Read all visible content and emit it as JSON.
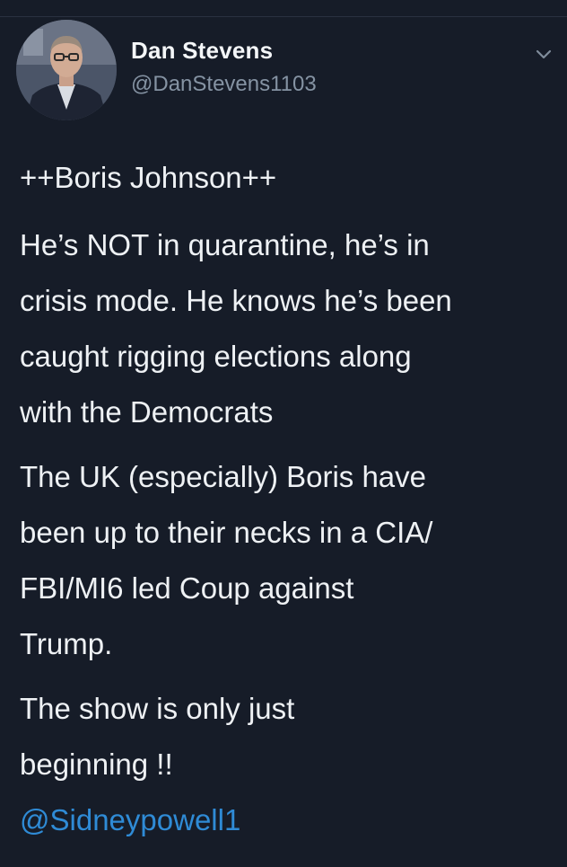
{
  "user": {
    "display_name": "Dan Stevens",
    "handle": "@DanStevens1103"
  },
  "icons": {
    "avatar": "profile-photo",
    "menu": "chevron-down-icon"
  },
  "tweet": {
    "heading": "++Boris Johnson++",
    "paragraphs": [
      "He’s NOT in quarantine, he’s in\ncrisis mode. He knows he’s been\ncaught rigging elections along\nwith the Democrats",
      "The UK (especially) Boris have\nbeen up to their necks in a CIA/\nFBI/MI6 led Coup against\nTrump.",
      "The show is only just\nbeginning !!"
    ],
    "mention": "@Sidneypowell1"
  },
  "colors": {
    "background": "#161c28",
    "text": "#eef1f4",
    "handle": "#8593a3",
    "link": "#2f8bd6"
  }
}
